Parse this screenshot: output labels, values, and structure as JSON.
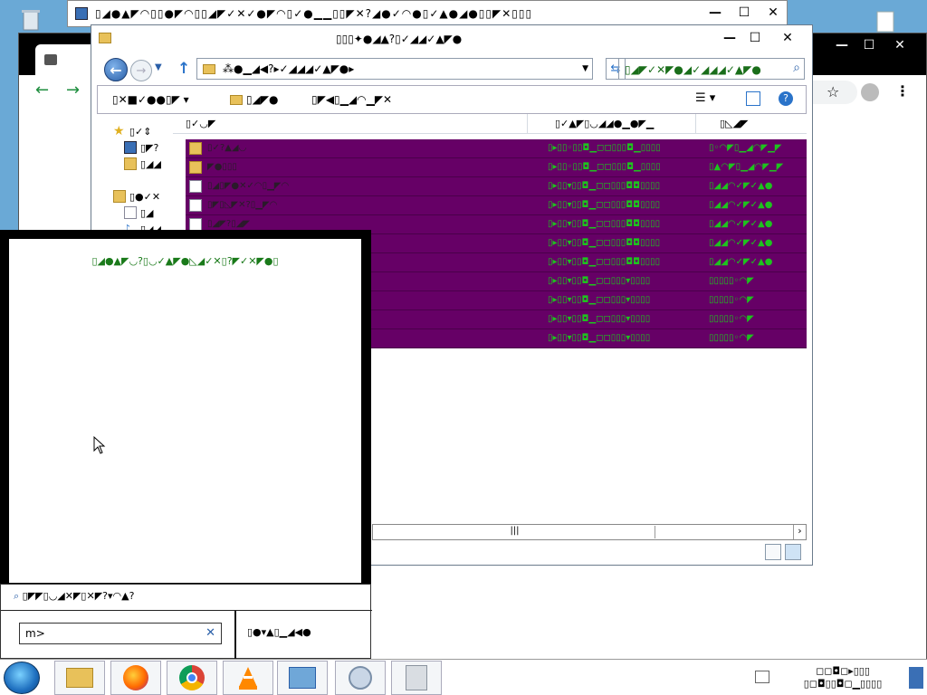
{
  "bg_window": {
    "title": "▯◢●▲◤◠▯▯●◤◠▯▯◢◤✓✕✓●◤◠▯✓●▁▁▯▯◤✕?◢●✓◠●▯✓▲●◢●▯▯◤✕▯▯▯",
    "minimize": "—",
    "maximize": "☐",
    "close": "✕"
  },
  "chrome_window": {
    "minimize": "—",
    "maximize": "☐",
    "close": "✕",
    "tab_text": "▯"
  },
  "explorer": {
    "title": "▯▯▯✦●◢▲?▯✓◢◢✓▲◤●",
    "minimize": "—",
    "maximize": "☐",
    "close": "✕",
    "breadcrumb": "⁂●▁◢◀?▸✓◢◢◢✓▲◤●▸",
    "search_placeholder": "▯◢◤✓✕◤●◢✓◢◢◢✓▲◤●",
    "commands": {
      "organize": "▯✕■✓●●▯◤",
      "share": "▯◢◤●",
      "new_folder": "▯◤◀▯▁◢◠▁◤✕"
    },
    "columns": {
      "name": "▯✓◡◤",
      "date": "▯✓▲◤▯◡◢◢●▁●◤▁",
      "type": "▯◺◢◤"
    },
    "nav": [
      {
        "label": "▯✓⇕",
        "icon": "star-icon"
      },
      {
        "label": "▯◤?",
        "icon": "desktop-icon"
      },
      {
        "label": "▯◢◢",
        "icon": "downloads-icon"
      },
      {
        "label": "▯●✓✕",
        "icon": "library-icon"
      },
      {
        "label": "▯◢",
        "icon": "document-icon"
      },
      {
        "label": "▯◢◢",
        "icon": "music-icon"
      }
    ],
    "files": [
      {
        "name": "▯✓?▲◢◡",
        "date": "▯▸▯▯◦▯▯◘▁◻◻▯▯▯◘▁▯▯▯▯",
        "type": "▯◦◠◤▯▁◢◠◤▁◤",
        "kind": "folder"
      },
      {
        "name": "◤●▯▯▯",
        "date": "▯▸▯▯◦▯▯◘▁◻◻▯▯▯◘▁▯▯▯▯",
        "type": "▯▲◠◤▯▁◢◠◤▁◤",
        "kind": "folder"
      },
      {
        "name": "▯◢▯◤●✕✓◠▯▁◤◠",
        "date": "▯▸▯▯▾▯▯◘▁◻◻▯▯▯◘◘▯▯▯▯",
        "type": "▯◢◢◠✓◤✓▲●",
        "kind": "file"
      },
      {
        "name": "▯◤▯◺◤✕?▯▁◤◠",
        "date": "▯▸▯▯▾▯▯◘▁◻◻▯▯▯◘◘▯▯▯▯",
        "type": "▯◢◢◠✓◤✓▲●",
        "kind": "file"
      },
      {
        "name": "▯◢◤?▯◢◤",
        "date": "▯▸▯▯▾▯▯◘▁◻◻▯▯▯◘◘▯▯▯▯",
        "type": "▯◢◢◠✓◤✓▲●",
        "kind": "file"
      },
      {
        "name": "",
        "date": "▯▸▯▯▾▯▯◘▁◻◻▯▯▯◘◘▯▯▯▯",
        "type": "▯◢◢◠✓◤✓▲●",
        "kind": "file"
      },
      {
        "name": "",
        "date": "▯▸▯▯▾▯▯◘▁◻◻▯▯▯◘◘▯▯▯▯",
        "type": "▯◢◢◠✓◤✓▲●",
        "kind": "file"
      },
      {
        "name": "",
        "date": "▯▸▯▯▾▯▯◘▁◻◻▯▯▯▾▯▯▯▯",
        "type": "▯▯▯▯▯◦◠◤",
        "kind": "file"
      },
      {
        "name": "",
        "date": "▯▸▯▯▾▯▯◘▁◻◻▯▯▯▾▯▯▯▯",
        "type": "▯▯▯▯▯◦◠◤",
        "kind": "file"
      },
      {
        "name": "",
        "date": "▯▸▯▯▾▯▯◘▁◻◻▯▯▯▾▯▯▯▯",
        "type": "▯▯▯▯▯◦◠◤",
        "kind": "file"
      },
      {
        "name": "",
        "date": "▯▸▯▯▾▯▯◘▁◻◻▯▯▯▾▯▯▯▯",
        "type": "▯▯▯▯▯◦◠◤",
        "kind": "file"
      }
    ],
    "hscroll_thumb": "|||",
    "hscroll_arrow": "›"
  },
  "overlay": {
    "heading": "▯◢●▲◤◡?▯◡✓▲◤●◺◢✓✕▯?◤✓✕◤●▯",
    "search_hint": "▯◤◤▯◡◢✕◤▯✕◤?▾◠▲?",
    "input_value": "m>",
    "clear": "✕",
    "right_text": "▯●▾▲▯▁◢◀●"
  },
  "taskbar": {
    "clock_time": "◻◻◘◻▸▯▯▯",
    "clock_date": "▯◻◘▯▯◘◻▁▯▯▯▯"
  },
  "colors": {
    "selection_row": "#660066",
    "green_text": "#1ec31e",
    "desktop": "#6aa9d6"
  }
}
